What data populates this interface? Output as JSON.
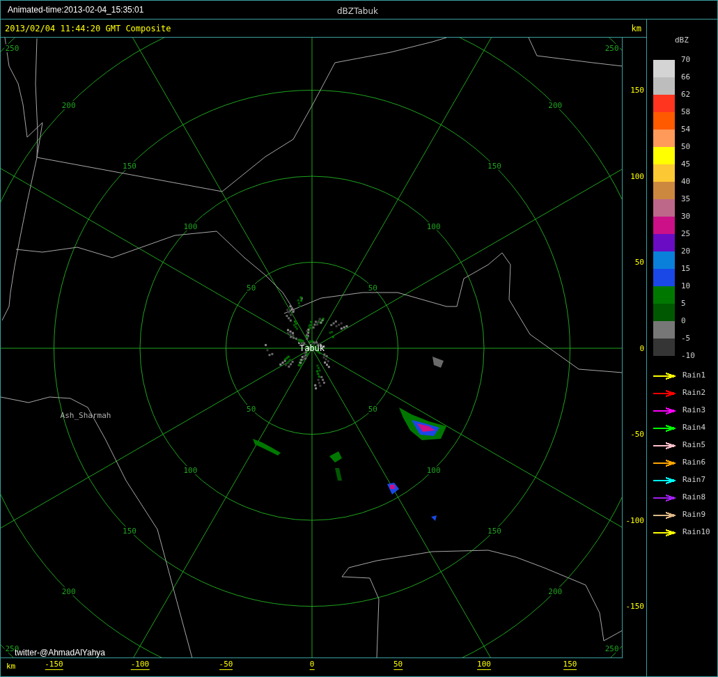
{
  "title_bar": {
    "animated_time": "Animated-time:2013-02-04_15:35:01",
    "title": "dBZTabuk"
  },
  "plot_header": {
    "timestamp": "2013/02/04 11:44:20 GMT Composite",
    "unit": "km"
  },
  "range_rings": [
    {
      "labels": [
        "50",
        "50",
        "50",
        "50"
      ]
    },
    {
      "labels": [
        "100",
        "100",
        "100",
        "100"
      ]
    },
    {
      "labels": [
        "150",
        "150",
        "150",
        "150"
      ]
    },
    {
      "labels": [
        "200",
        "200",
        "200",
        "200"
      ]
    },
    {
      "labels": [
        "250",
        "250",
        "250",
        "250"
      ]
    }
  ],
  "places": [
    {
      "kind": "station",
      "name": "Tabuk"
    },
    {
      "kind": "town",
      "name": "Ash_Sharmah"
    }
  ],
  "credit": "twitter-@AhmadAlYahya",
  "y_axis": {
    "ticks": [
      "150",
      "100",
      "50",
      "0",
      "-50",
      "-100",
      "-150"
    ]
  },
  "x_axis": {
    "unit": "km",
    "ticks": [
      "-150",
      "-100",
      "-50",
      "0",
      "50",
      "100",
      "150"
    ]
  },
  "legend": {
    "title": "dBZ",
    "labels": [
      "70",
      "66",
      "62",
      "58",
      "54",
      "50",
      "45",
      "40",
      "35",
      "30",
      "25",
      "20",
      "15",
      "10",
      "5",
      "0",
      "-5",
      "-10"
    ],
    "bins": [
      {
        "color": "#d4d4d4"
      },
      {
        "color": "#bdbdbd"
      },
      {
        "color": "#ff3520"
      },
      {
        "color": "#ff5a00"
      },
      {
        "color": "#ff9a5a"
      },
      {
        "color": "#ffff00"
      },
      {
        "color": "#fcc833"
      },
      {
        "color": "#cd8840"
      },
      {
        "color": "#bd6888"
      },
      {
        "color": "#cb1088"
      },
      {
        "color": "#6a0cc4"
      },
      {
        "color": "#0a80da"
      },
      {
        "color": "#1a48e6"
      },
      {
        "color": "#007800"
      },
      {
        "color": "#005800"
      },
      {
        "color": "#777777"
      },
      {
        "color": "#353535"
      }
    ]
  },
  "tracks": [
    {
      "label": "Rain1",
      "color": "#ffff00"
    },
    {
      "label": "Rain2",
      "color": "#ff0000"
    },
    {
      "label": "Rain3",
      "color": "#ff00ff"
    },
    {
      "label": "Rain4",
      "color": "#00ff00"
    },
    {
      "label": "Rain5",
      "color": "#ffc0cb"
    },
    {
      "label": "Rain6",
      "color": "#ffa500"
    },
    {
      "label": "Rain7",
      "color": "#00ffff"
    },
    {
      "label": "Rain8",
      "color": "#a020f0"
    },
    {
      "label": "Rain9",
      "color": "#deb887"
    },
    {
      "label": "Rain10",
      "color": "#ffff00"
    }
  ]
}
